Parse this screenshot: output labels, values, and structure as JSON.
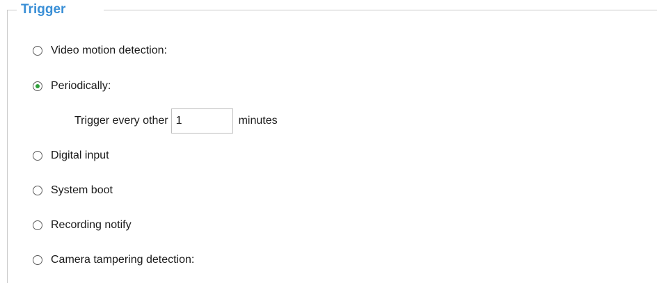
{
  "trigger": {
    "legend": "Trigger",
    "options": [
      {
        "label": "Video motion detection:",
        "checked": false
      },
      {
        "label": "Periodically:",
        "checked": true
      },
      {
        "label": "Digital input",
        "checked": false
      },
      {
        "label": "System boot",
        "checked": false
      },
      {
        "label": "Recording notify",
        "checked": false
      },
      {
        "label": "Camera tampering detection:",
        "checked": false
      }
    ],
    "periodic": {
      "prefix": "Trigger every other",
      "value": "1",
      "suffix": "minutes"
    }
  },
  "colors": {
    "legend": "#3a8fd6",
    "radio_dot": "#2ea03a",
    "frame": "#c8c8c8"
  }
}
